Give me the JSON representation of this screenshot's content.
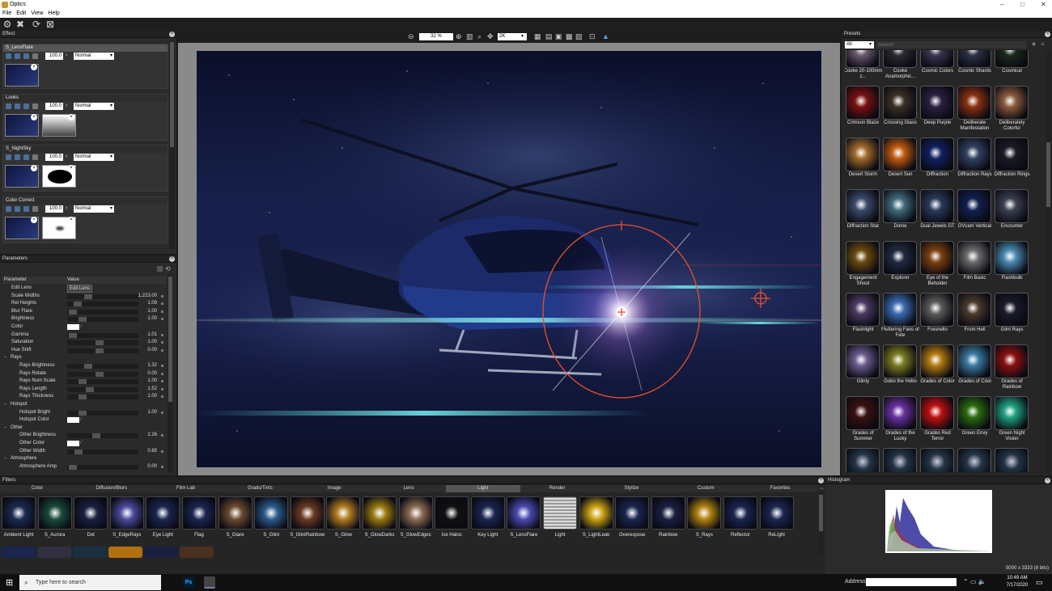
{
  "app": {
    "title": "Optics"
  },
  "menu": [
    "File",
    "Edit",
    "View",
    "Help"
  ],
  "effect_panel": {
    "title": "Effect",
    "layers": [
      {
        "name": "S_LensFlare",
        "opacity": "100.0",
        "blend": "Normal",
        "selected": true
      },
      {
        "name": "Looks",
        "opacity": "100.0",
        "blend": "Normal",
        "selected": false
      },
      {
        "name": "S_NightSky",
        "opacity": "100.0",
        "blend": "Normal",
        "selected": false
      },
      {
        "name": "Color Correct",
        "opacity": "100.0",
        "blend": "Normal",
        "selected": false
      }
    ]
  },
  "parameters_panel": {
    "title": "Parameters",
    "col_parameter": "Parameter",
    "col_value": "Value",
    "rows": [
      {
        "label": "Edit Lens",
        "type": "button",
        "button": "Edit Lens",
        "indent": 1
      },
      {
        "label": "Scale Widths",
        "value": "1,223.00",
        "pos": 0.27,
        "indent": 1
      },
      {
        "label": "Rel Heights",
        "value": "1.09",
        "pos": 0.1,
        "indent": 1
      },
      {
        "label": "Blur Flare",
        "value": "1.00",
        "pos": 0.02,
        "indent": 1
      },
      {
        "label": "Brightness",
        "value": "1.00",
        "pos": 0.18,
        "indent": 1
      },
      {
        "label": "Color",
        "type": "color",
        "indent": 1
      },
      {
        "label": "Gamma",
        "value": "1.01",
        "pos": 0.02,
        "indent": 1
      },
      {
        "label": "Saturation",
        "value": "1.00",
        "pos": 0.45,
        "indent": 1
      },
      {
        "label": "Hue Shift",
        "value": "0.00",
        "pos": 0.45,
        "indent": 1
      },
      {
        "label": "Rays",
        "type": "group",
        "indent": 0
      },
      {
        "label": "Rays Brightness",
        "value": "1.32",
        "pos": 0.27,
        "indent": 2
      },
      {
        "label": "Rays Rotate",
        "value": "0.00",
        "pos": 0.45,
        "indent": 2
      },
      {
        "label": "Rays Num Scale",
        "value": "1.00",
        "pos": 0.18,
        "indent": 2
      },
      {
        "label": "Rays Length",
        "value": "1.52",
        "pos": 0.3,
        "indent": 2
      },
      {
        "label": "Rays Thickness",
        "value": "1.00",
        "pos": 0.18,
        "indent": 2
      },
      {
        "label": "Hotspot",
        "type": "group",
        "indent": 0
      },
      {
        "label": "Hotspot Bright",
        "value": "1.00",
        "pos": 0.18,
        "indent": 2
      },
      {
        "label": "Hotspot Color",
        "type": "color",
        "indent": 2
      },
      {
        "label": "Other",
        "type": "group",
        "indent": 0
      },
      {
        "label": "Other Brightness",
        "value": "2.26",
        "pos": 0.4,
        "indent": 2
      },
      {
        "label": "Other Color",
        "type": "color",
        "indent": 2
      },
      {
        "label": "Other Width",
        "value": "0.65",
        "pos": 0.12,
        "indent": 2
      },
      {
        "label": "Atmosphere",
        "type": "group",
        "indent": 0
      },
      {
        "label": "Atmosphere Amp",
        "value": "0.00",
        "pos": 0.02,
        "indent": 2
      }
    ]
  },
  "viewer": {
    "zoom": "32 %",
    "resolution": "2K"
  },
  "presets_panel": {
    "title": "Presets",
    "filter": "All",
    "search_placeholder": "Search",
    "items": [
      "Cooke 20-100mm z...",
      "Cooke Anamorphic...",
      "Cosmic Colors",
      "Cosmic Shards",
      "Cosmical",
      "Crimson Blaze",
      "Crossing Glass",
      "Deep Purple",
      "Deliberate Manifestation",
      "Deliberately Colorful",
      "Desert Storm",
      "Desert Sun",
      "Diffraction",
      "Diffraction Rays",
      "Diffraction Rings",
      "Diffraction Star",
      "Dome",
      "Dual Jewels GT",
      "DVcam Vertical",
      "Encounter",
      "Engagement Shoot",
      "Explorer",
      "Eye of the Beholder",
      "Film Basic",
      "Flashbulb",
      "Flashlight",
      "Fluttering Fans of Fate",
      "Fresnello",
      "From Hell",
      "Glint Rays",
      "Glinty",
      "Gobo the Hobo",
      "Grades of Color",
      "Grades of Cool",
      "Grades of Rainbow",
      "Grades of Summer",
      "Grades of the Lucky",
      "Grades Red Terror",
      "Green Envy",
      "Green Night Vision"
    ],
    "colors": [
      "#6a5a70",
      "#2a2a30",
      "#3a3550",
      "#2c3348",
      "#1a2a1a",
      "#7a1010",
      "#3a3024",
      "#2a2040",
      "#8a3010",
      "#8a5a3a",
      "#a06a2a",
      "#c05a10",
      "#102060",
      "#304060",
      "#1a1a24",
      "#3a4a6a",
      "#406a7a",
      "#2a3a5a",
      "#102050",
      "#3a4050",
      "#6a4a10",
      "#202a40",
      "#7a4010",
      "#6a6a6a",
      "#4a8ab0",
      "#4a3a60",
      "#3a6ab0",
      "#5a5a5a",
      "#4a3a2a",
      "#1a1a2a",
      "#6a5a8a",
      "#7a7a20",
      "#b07a10",
      "#3a7aa0",
      "#8a1010",
      "#3a1010",
      "#6a30a0",
      "#c01010",
      "#2a6a10",
      "#20a080"
    ]
  },
  "filters_panel": {
    "title": "Filters",
    "categories": [
      "Color",
      "Diffusion/Blurs",
      "Film Lab",
      "Grads/Tints",
      "Image",
      "Lens",
      "Light",
      "Render",
      "Stylize",
      "Custom",
      "Favorites"
    ],
    "active_category": "Light",
    "items": [
      "Ambient Light",
      "S_Aurora",
      "Dot",
      "S_EdgeRays",
      "Eye Light",
      "Flag",
      "S_Glare",
      "S_Glint",
      "S_GlintRainbow",
      "S_Glow",
      "S_GlowDarks",
      "S_GlowEdges",
      "Ice Halos",
      "Key Light",
      "S_LensFlare",
      "Light",
      "S_LightLeak",
      "Overexpose",
      "Rainbow",
      "S_Rays",
      "Reflector",
      "ReLight"
    ],
    "colors": [
      "#1a2a50",
      "#1a4a3a",
      "#1a2040",
      "#4a4a9a",
      "#1a2550",
      "#1a2550",
      "#6a4a30",
      "#2a5a8a",
      "#6a3a20",
      "#b07a20",
      "#9a7a10",
      "#8a6a50",
      "#101010",
      "#1a2550",
      "#4a4ab0",
      "#c8c8c8",
      "#c8a010",
      "#1a2550",
      "#1a2040",
      "#b08010",
      "#1a2550",
      "#1a2550"
    ]
  },
  "histogram_panel": {
    "title": "Histogram",
    "image_info": "5000 x 3333 (8 bits)"
  },
  "taskbar": {
    "search_placeholder": "Type here to search",
    "address_label": "Address",
    "time": "10:49 AM",
    "date": "7/17/2020"
  }
}
